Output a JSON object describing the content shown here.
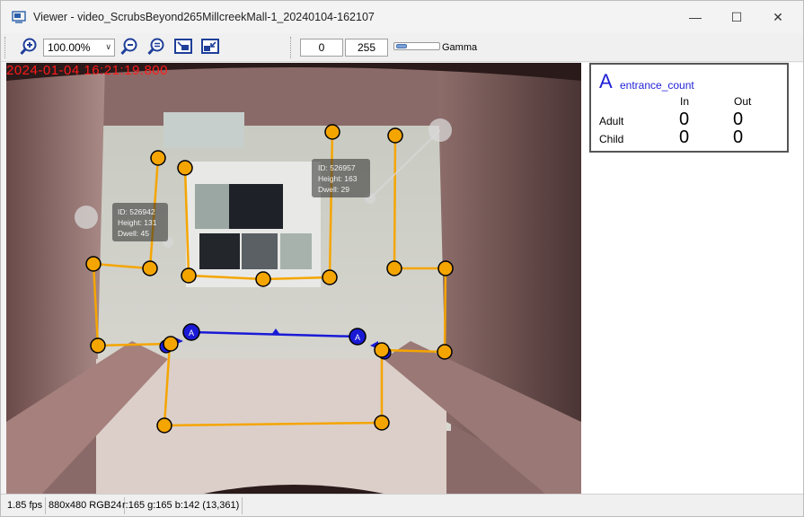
{
  "window": {
    "title": "Viewer - video_ScrubsBeyond265MillcreekMall-1_20240104-162107",
    "minimize_glyph": "—",
    "maximize_glyph": "☐",
    "close_glyph": "✕"
  },
  "toolbar": {
    "zoom_value": "100.00%",
    "min_value": "0",
    "max_value": "255",
    "gamma_label": "Gamma",
    "icons": [
      "zoom-in-icon",
      "zoom-out-icon",
      "zoom-reset-icon",
      "fit-window-icon",
      "shrink-window-icon"
    ]
  },
  "video": {
    "timestamp": "2024-01-04 16:21:19.800",
    "tracks": [
      {
        "id_text": "ID: 526942",
        "height_text": "Height: 131",
        "dwell_text": "Dwell: 45"
      },
      {
        "id_text": "ID: 526957",
        "height_text": "Height: 163",
        "dwell_text": "Dwell: 29"
      }
    ],
    "line_label_left": "A",
    "line_label_right": "A",
    "colors": {
      "zone": "#f5a500",
      "line": "#1a1ad6",
      "timestamp": "#ff1a1a"
    }
  },
  "count_panel": {
    "letter": "A",
    "name": "entrance_count",
    "col_in": "In",
    "col_out": "Out",
    "rows": [
      {
        "label": "Adult",
        "in": "0",
        "out": "0"
      },
      {
        "label": "Child",
        "in": "0",
        "out": "0"
      }
    ]
  },
  "status": {
    "fps": "1.85 fps",
    "format": "880x480 RGB24",
    "pixel": "r:165 g:165 b:142 (13,361)"
  }
}
